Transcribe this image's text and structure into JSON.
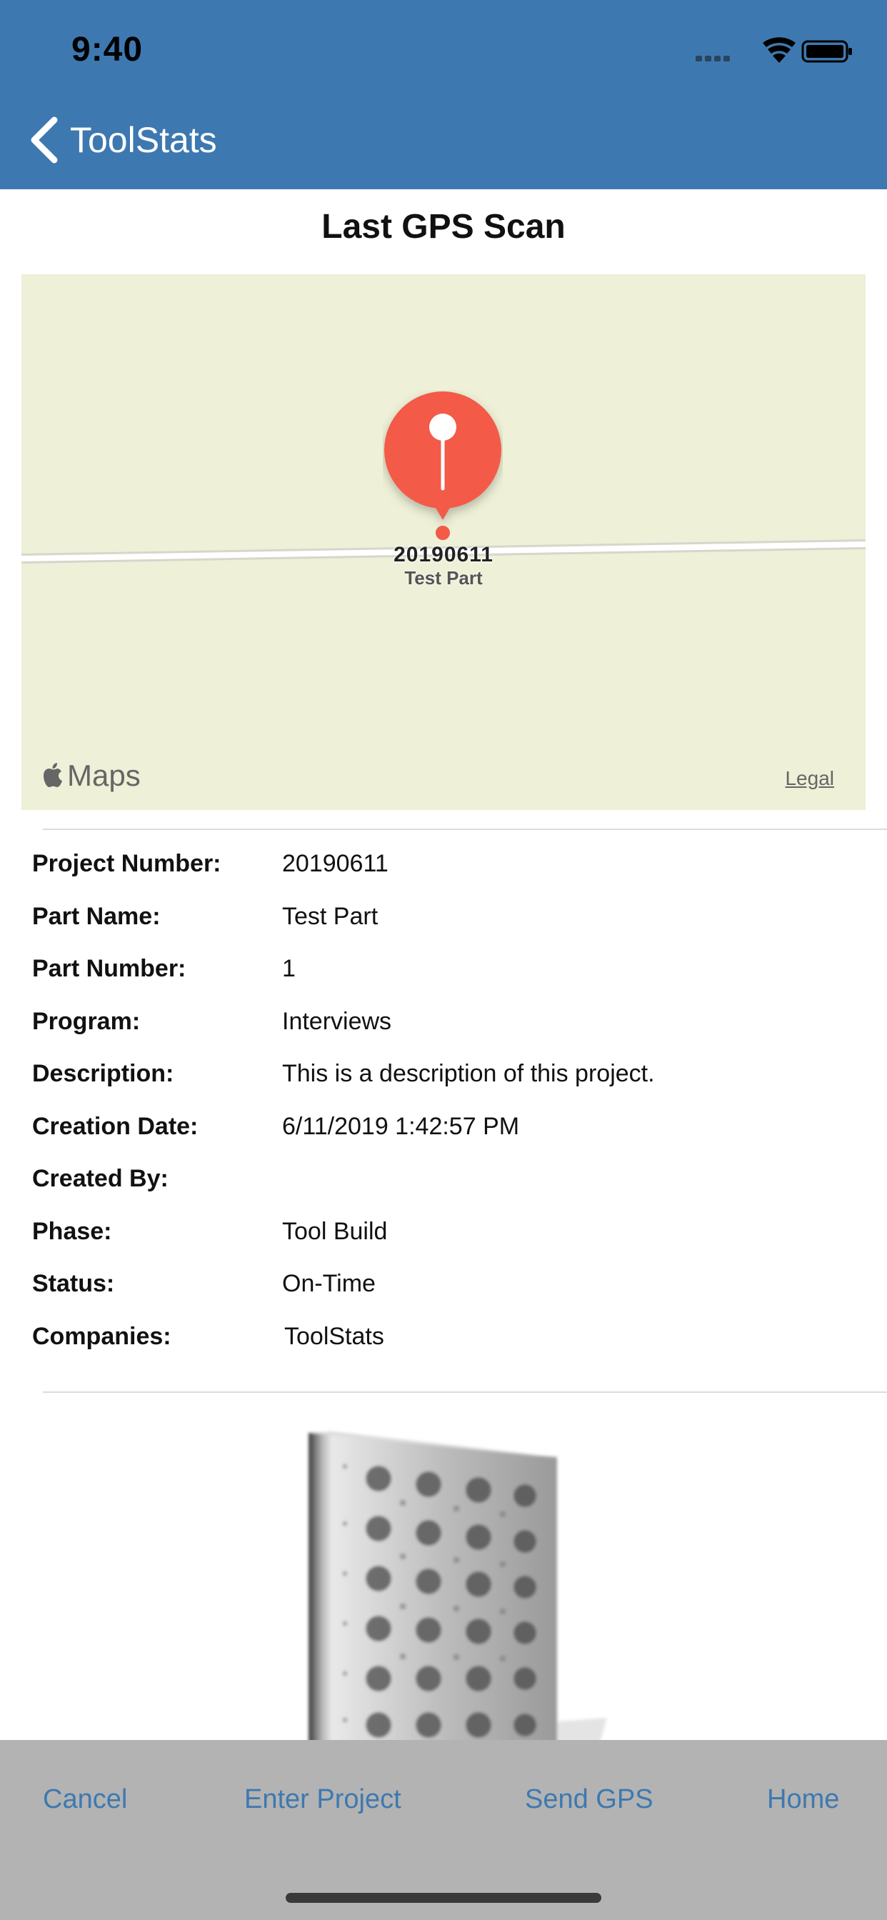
{
  "status_bar": {
    "time": "9:40"
  },
  "nav": {
    "back_label": "ToolStats"
  },
  "section": {
    "title": "Last GPS Scan"
  },
  "map": {
    "pin_title": "20190611",
    "pin_subtitle": "Test Part",
    "brand": "Maps",
    "legal": "Legal",
    "pin_color": "#f35a47",
    "land_color": "#eef0d7"
  },
  "project_details": [
    {
      "label": "Project Number:",
      "value": "20190611"
    },
    {
      "label": "Part Name:",
      "value": "Test Part"
    },
    {
      "label": "Part Number:",
      "value": "1"
    },
    {
      "label": "Program:",
      "value": "Interviews"
    },
    {
      "label": "Description:",
      "value": "This is a description of this project."
    },
    {
      "label": "Creation Date:",
      "value": "6/11/2019 1:42:57 PM"
    },
    {
      "label": "Created By:",
      "value": ""
    },
    {
      "label": "Phase:",
      "value": "Tool Build"
    },
    {
      "label": "Status:",
      "value": "On-Time"
    },
    {
      "label": "Companies:",
      "value": "ToolStats"
    }
  ],
  "toolbar": {
    "cancel": "Cancel",
    "enter_project": "Enter Project",
    "send_gps": "Send GPS",
    "home": "Home"
  },
  "colors": {
    "nav_blue": "#3d79b0",
    "toolbar_gray": "#b3b3b3"
  }
}
